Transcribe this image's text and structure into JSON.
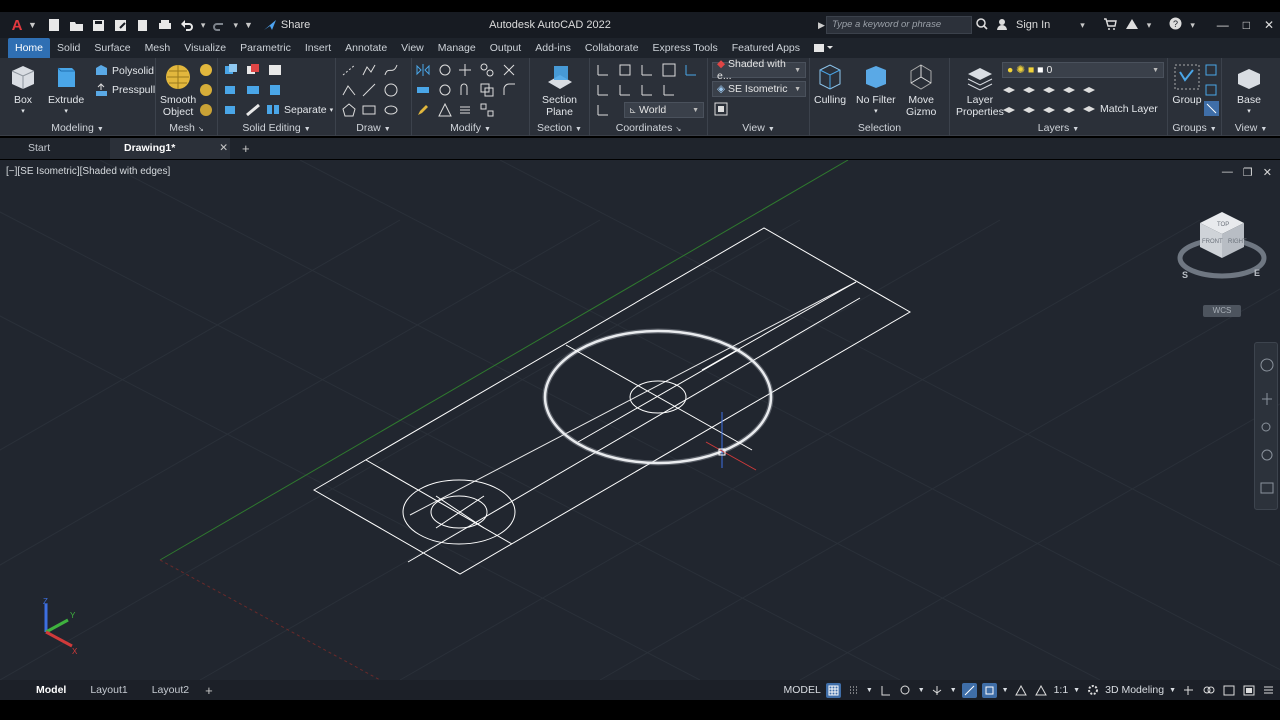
{
  "titlebar": {
    "logo": "A",
    "app_title": "Autodesk AutoCAD 2022",
    "share_label": "Share",
    "search_placeholder": "Type a keyword or phrase",
    "signin_label": "Sign In"
  },
  "ribbon_tabs": [
    "Home",
    "Solid",
    "Surface",
    "Mesh",
    "Visualize",
    "Parametric",
    "Insert",
    "Annotate",
    "View",
    "Manage",
    "Output",
    "Add-ins",
    "Collaborate",
    "Express Tools",
    "Featured Apps"
  ],
  "panels": {
    "modeling": {
      "label": "Modeling",
      "box": "Box",
      "extrude": "Extrude",
      "polysolid": "Polysolid",
      "presspull": "Presspull"
    },
    "mesh": {
      "label": "Mesh",
      "smooth_object_line1": "Smooth",
      "smooth_object_line2": "Object"
    },
    "solid_editing": {
      "label": "Solid Editing",
      "separate": "Separate"
    },
    "draw": {
      "label": "Draw"
    },
    "modify": {
      "label": "Modify"
    },
    "section": {
      "label": "Section",
      "section_plane_line1": "Section",
      "section_plane_line2": "Plane"
    },
    "coordinates": {
      "label": "Coordinates",
      "world": "World"
    },
    "view": {
      "label": "View",
      "visual_style": "Shaded with e...",
      "view_preset": "SE Isometric"
    },
    "selection": {
      "label": "Selection",
      "culling": "Culling",
      "no_filter": "No Filter",
      "move_gizmo_line1": "Move",
      "move_gizmo_line2": "Gizmo"
    },
    "layers": {
      "label": "Layers",
      "layer_properties_line1": "Layer",
      "layer_properties_line2": "Properties",
      "current_layer": "0",
      "match_layer": "Match Layer"
    },
    "groups": {
      "label": "Groups",
      "group": "Group"
    },
    "view2": {
      "label": "View",
      "base": "Base"
    }
  },
  "file_tabs": {
    "start": "Start",
    "drawing": "Drawing1*"
  },
  "viewport": {
    "label": "[−][SE Isometric][Shaded with edges]",
    "wcs": "WCS",
    "viewcube_top": "TOP",
    "viewcube_front": "FRONT",
    "viewcube_right": "RIGHT",
    "compass_s": "S",
    "compass_e": "E"
  },
  "layout_tabs": [
    "Model",
    "Layout1",
    "Layout2"
  ],
  "statusbar": {
    "model": "MODEL",
    "scale": "1:1",
    "workspace": "3D Modeling"
  },
  "colors": {
    "accent": "#2f6fb3",
    "viewport_bg": "#21262f",
    "ribbon_bg": "#2b3039",
    "geometry": "#ffffff"
  }
}
